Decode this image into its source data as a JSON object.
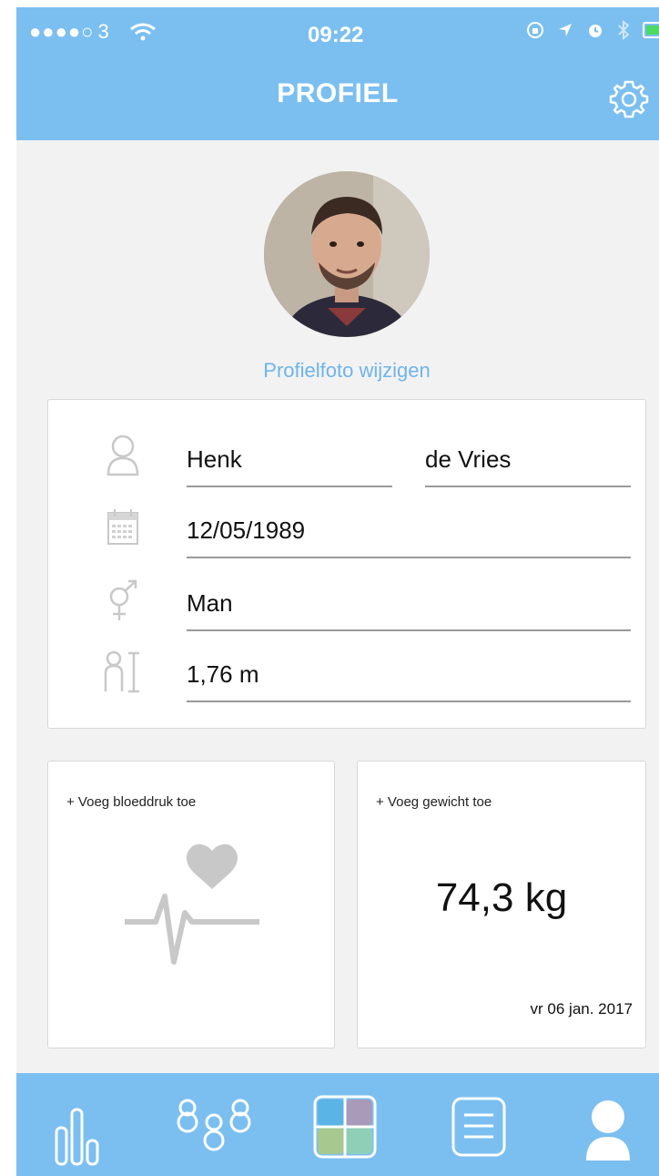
{
  "status_bar": {
    "signal": "●●●●○",
    "carrier": "3",
    "time": "09:22"
  },
  "header": {
    "title": "PROFIEL"
  },
  "profile": {
    "change_photo_label": "Profielfoto wijzigen",
    "first_name": "Henk",
    "last_name": "de Vries",
    "birth_date": "12/05/1989",
    "gender": "Man",
    "height": "1,76 m"
  },
  "blood_pressure": {
    "add_label": "+ Voeg bloeddruk toe"
  },
  "weight": {
    "add_label": "+ Voeg gewicht toe",
    "value": "74,3 kg",
    "date": "vr 06 jan. 2017"
  },
  "tabs": [
    "stats-icon",
    "people-icon",
    "dashboard-icon",
    "list-icon",
    "profile-icon"
  ],
  "colors": {
    "primary": "#7bbff0",
    "link": "#6fb4ea",
    "background": "#f2f2f2",
    "battery": "#4cd964"
  }
}
